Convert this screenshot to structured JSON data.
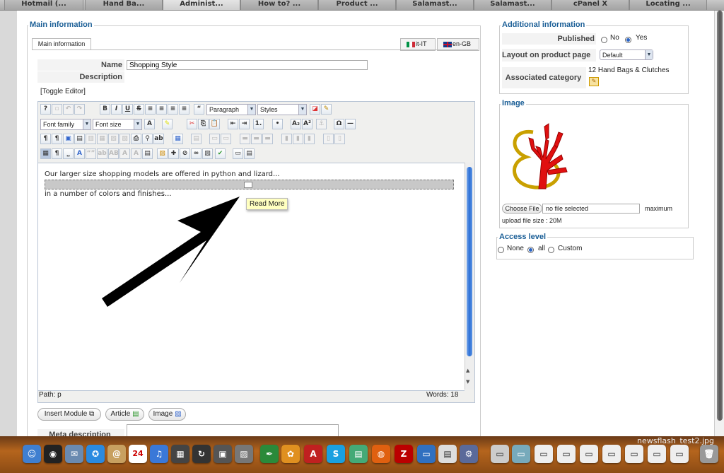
{
  "browser_tabs": [
    "Hotmail (...",
    "Hand Ba...",
    "Administ...",
    "How to? ...",
    "Product ...",
    "Salamast...",
    "Salamast...",
    "cPanel X",
    "Locating ..."
  ],
  "main": {
    "legend": "Main information",
    "tab_label": "Main information",
    "lang_tabs": [
      "it-IT",
      "en-GB"
    ],
    "name_label": "Name",
    "name_value": "Shopping Style",
    "description_label": "Description",
    "toggle_editor": "[Toggle Editor]",
    "format_select": "Paragraph",
    "styles_select": "Styles",
    "font_family": "Font family",
    "font_size": "Font size",
    "editor_line1": "Our larger size shopping models are offered in python and lizard...",
    "editor_line2": "in a number of colors and finishes...",
    "tooltip": "Read More",
    "path": "Path: p",
    "words": "Words: 18",
    "insert_module": "Insert Module",
    "article": "Article",
    "image": "Image",
    "meta_description": "Meta description"
  },
  "additional": {
    "legend": "Additional information",
    "published_label": "Published",
    "published_options": [
      "No",
      "Yes"
    ],
    "published_value": "Yes",
    "layout_label": "Layout on product page",
    "layout_value": "Default",
    "category_label": "Associated category",
    "category_value": "12 Hand Bags & Clutches"
  },
  "image_box": {
    "legend": "Image",
    "choose_file": "Choose File",
    "no_file": "no file selected",
    "maximum": "maximum",
    "upload_size": "upload file size : 20M"
  },
  "access": {
    "legend": "Access level",
    "options": [
      "None",
      "all",
      "Custom"
    ],
    "value": "all"
  },
  "desktop_filename": "newsflash_test2.jpg",
  "colors": {
    "legend_blue": "#1a5e96",
    "scroll_blue": "#2b6fd6",
    "tooltip_bg": "#ffffc0",
    "dock_orange": "#b5651d"
  }
}
